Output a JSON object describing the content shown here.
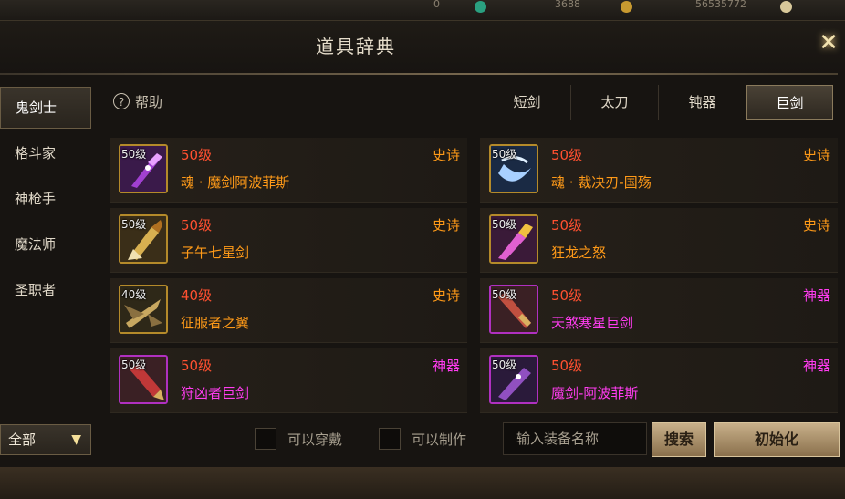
{
  "window": {
    "title": "道具辞典",
    "help_label": "帮助"
  },
  "hud": {
    "values": [
      "0",
      "3688",
      "56535772"
    ]
  },
  "sidebar": {
    "items": [
      {
        "label": "鬼剑士",
        "active": true
      },
      {
        "label": "格斗家",
        "active": false
      },
      {
        "label": "神枪手",
        "active": false
      },
      {
        "label": "魔法师",
        "active": false
      },
      {
        "label": "圣职者",
        "active": false
      }
    ]
  },
  "tabs": [
    {
      "label": "短剑",
      "active": false
    },
    {
      "label": "太刀",
      "active": false
    },
    {
      "label": "钝器",
      "active": false
    },
    {
      "label": "巨剑",
      "active": true
    }
  ],
  "items": [
    {
      "thumb_level": "50级",
      "level": "50级",
      "name": "魂 · 魔剑阿波菲斯",
      "grade": "史诗",
      "rarity": "epic",
      "icon": "purple-greatsword-icon"
    },
    {
      "thumb_level": "50级",
      "level": "50级",
      "name": "魂 · 裁决刃-国殇",
      "grade": "史诗",
      "rarity": "epic",
      "icon": "blue-blade-icon"
    },
    {
      "thumb_level": "50级",
      "level": "50级",
      "name": "子午七星剑",
      "grade": "史诗",
      "rarity": "epic",
      "icon": "golden-greatsword-icon"
    },
    {
      "thumb_level": "50级",
      "level": "50级",
      "name": "狂龙之怒",
      "grade": "史诗",
      "rarity": "epic",
      "icon": "dragon-sword-icon"
    },
    {
      "thumb_level": "40级",
      "level": "40级",
      "name": "征服者之翼",
      "grade": "史诗",
      "rarity": "epic",
      "icon": "winged-sword-icon"
    },
    {
      "thumb_level": "50级",
      "level": "50级",
      "name": "天煞寒星巨剑",
      "grade": "神器",
      "rarity": "legend",
      "icon": "red-greatsword-icon"
    },
    {
      "thumb_level": "50级",
      "level": "50级",
      "name": "狩凶者巨剑",
      "grade": "神器",
      "rarity": "legend",
      "icon": "hunter-greatsword-icon"
    },
    {
      "thumb_level": "50级",
      "level": "50级",
      "name": "魔剑-阿波菲斯",
      "grade": "神器",
      "rarity": "legend",
      "icon": "demon-sword-icon"
    }
  ],
  "bottom": {
    "filter_value": "全部",
    "wearable_label": "可以穿戴",
    "craftable_label": "可以制作",
    "search_placeholder": "输入装备名称",
    "search_button": "搜索",
    "reset_button": "初始化"
  },
  "colors": {
    "epic": "#ff9a18",
    "legend": "#ff3cf0",
    "level": "#ff5030",
    "accent": "#c8b08a"
  }
}
